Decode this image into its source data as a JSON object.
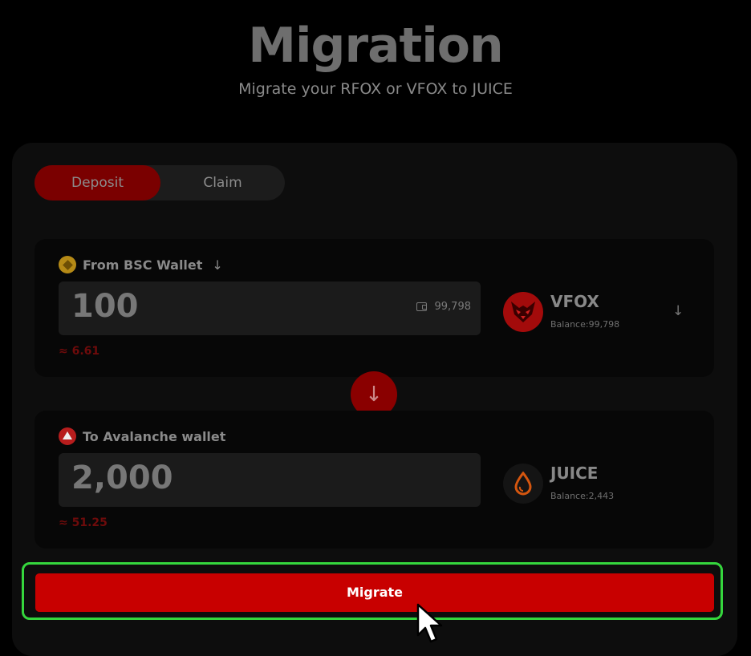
{
  "header": {
    "title": "Migration",
    "subtitle": "Migrate your RFOX or VFOX to JUICE"
  },
  "tabs": [
    {
      "label": "Deposit",
      "active": true
    },
    {
      "label": "Claim",
      "active": false
    }
  ],
  "from": {
    "label": "From BSC Wallet",
    "chain_icon": "bsc-icon",
    "amount": "100",
    "wallet_balance": "99,798",
    "usd_value": "≈ 6.61",
    "token": {
      "name": "VFOX",
      "balance": "Balance:99,798",
      "icon": "vfox-logo"
    }
  },
  "swap": {
    "icon": "arrow-down-icon"
  },
  "to": {
    "label": "To Avalanche wallet",
    "chain_icon": "avalanche-icon",
    "amount": "2,000",
    "usd_value": "≈ 51.25",
    "token": {
      "name": "JUICE",
      "balance": "Balance:2,443",
      "icon": "juice-logo"
    }
  },
  "actions": {
    "migrate_label": "Migrate"
  },
  "colors": {
    "accent": "#c80000",
    "highlight": "#35d63d",
    "background": "#000000"
  }
}
